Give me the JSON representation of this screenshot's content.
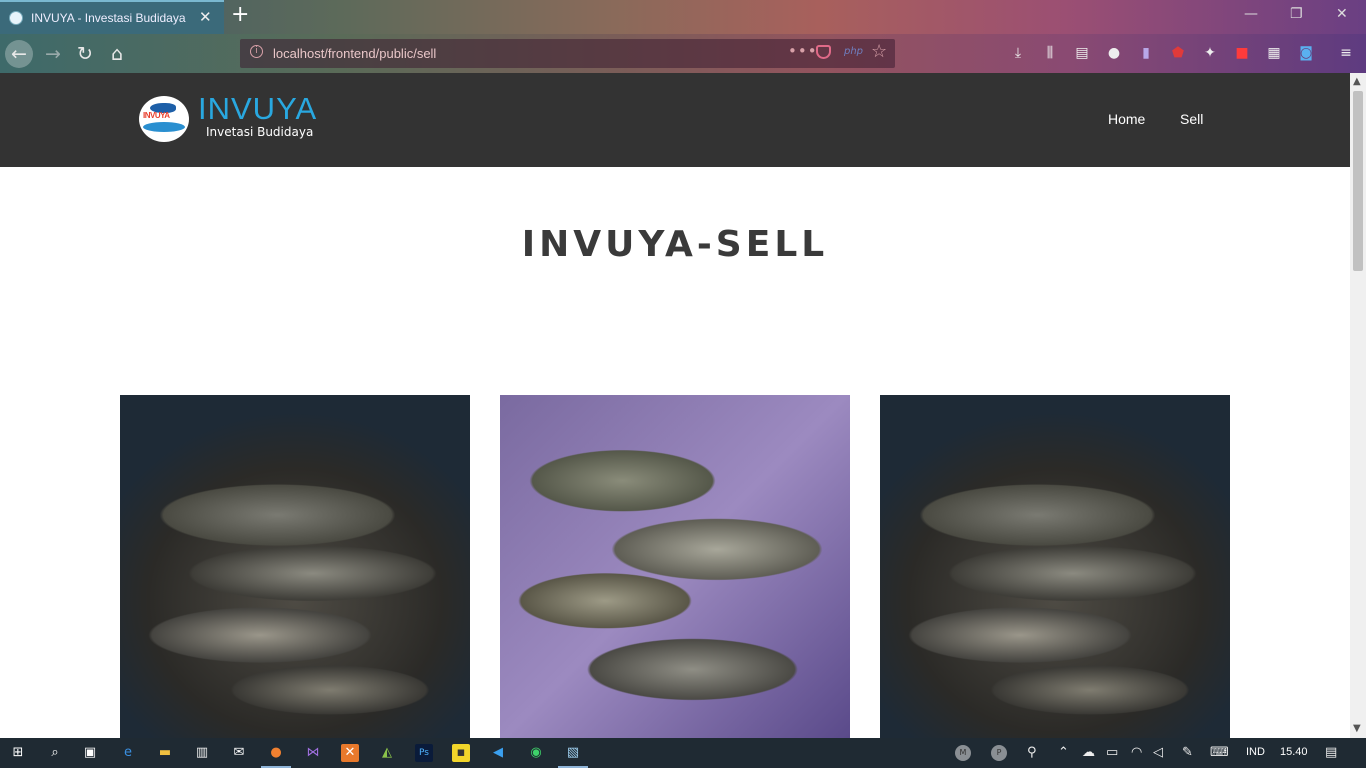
{
  "browser": {
    "tab_title": "INVUYA - Investasi Budidaya",
    "tab_close": "✕",
    "new_tab": "+",
    "url": "localhost/frontend/public/sell",
    "url_dots": "•••",
    "php_badge": "php",
    "window_controls": {
      "minimize": "—",
      "restore": "❐",
      "close": "✕"
    }
  },
  "site": {
    "logo_badge": "INVUYA",
    "logo_name": "INVUYA",
    "tagline": "Invetasi Budidaya",
    "nav": [
      {
        "label": "Home"
      },
      {
        "label": "Sell"
      }
    ],
    "page_title": "INVUYA-SELL",
    "products": [
      {
        "image": "snakehead-fish"
      },
      {
        "image": "tilapia-fish"
      },
      {
        "image": "snakehead-fish"
      }
    ]
  },
  "taskbar": {
    "tray_user1": "M",
    "tray_user2": "P",
    "language": "IND",
    "time": "15.40"
  }
}
